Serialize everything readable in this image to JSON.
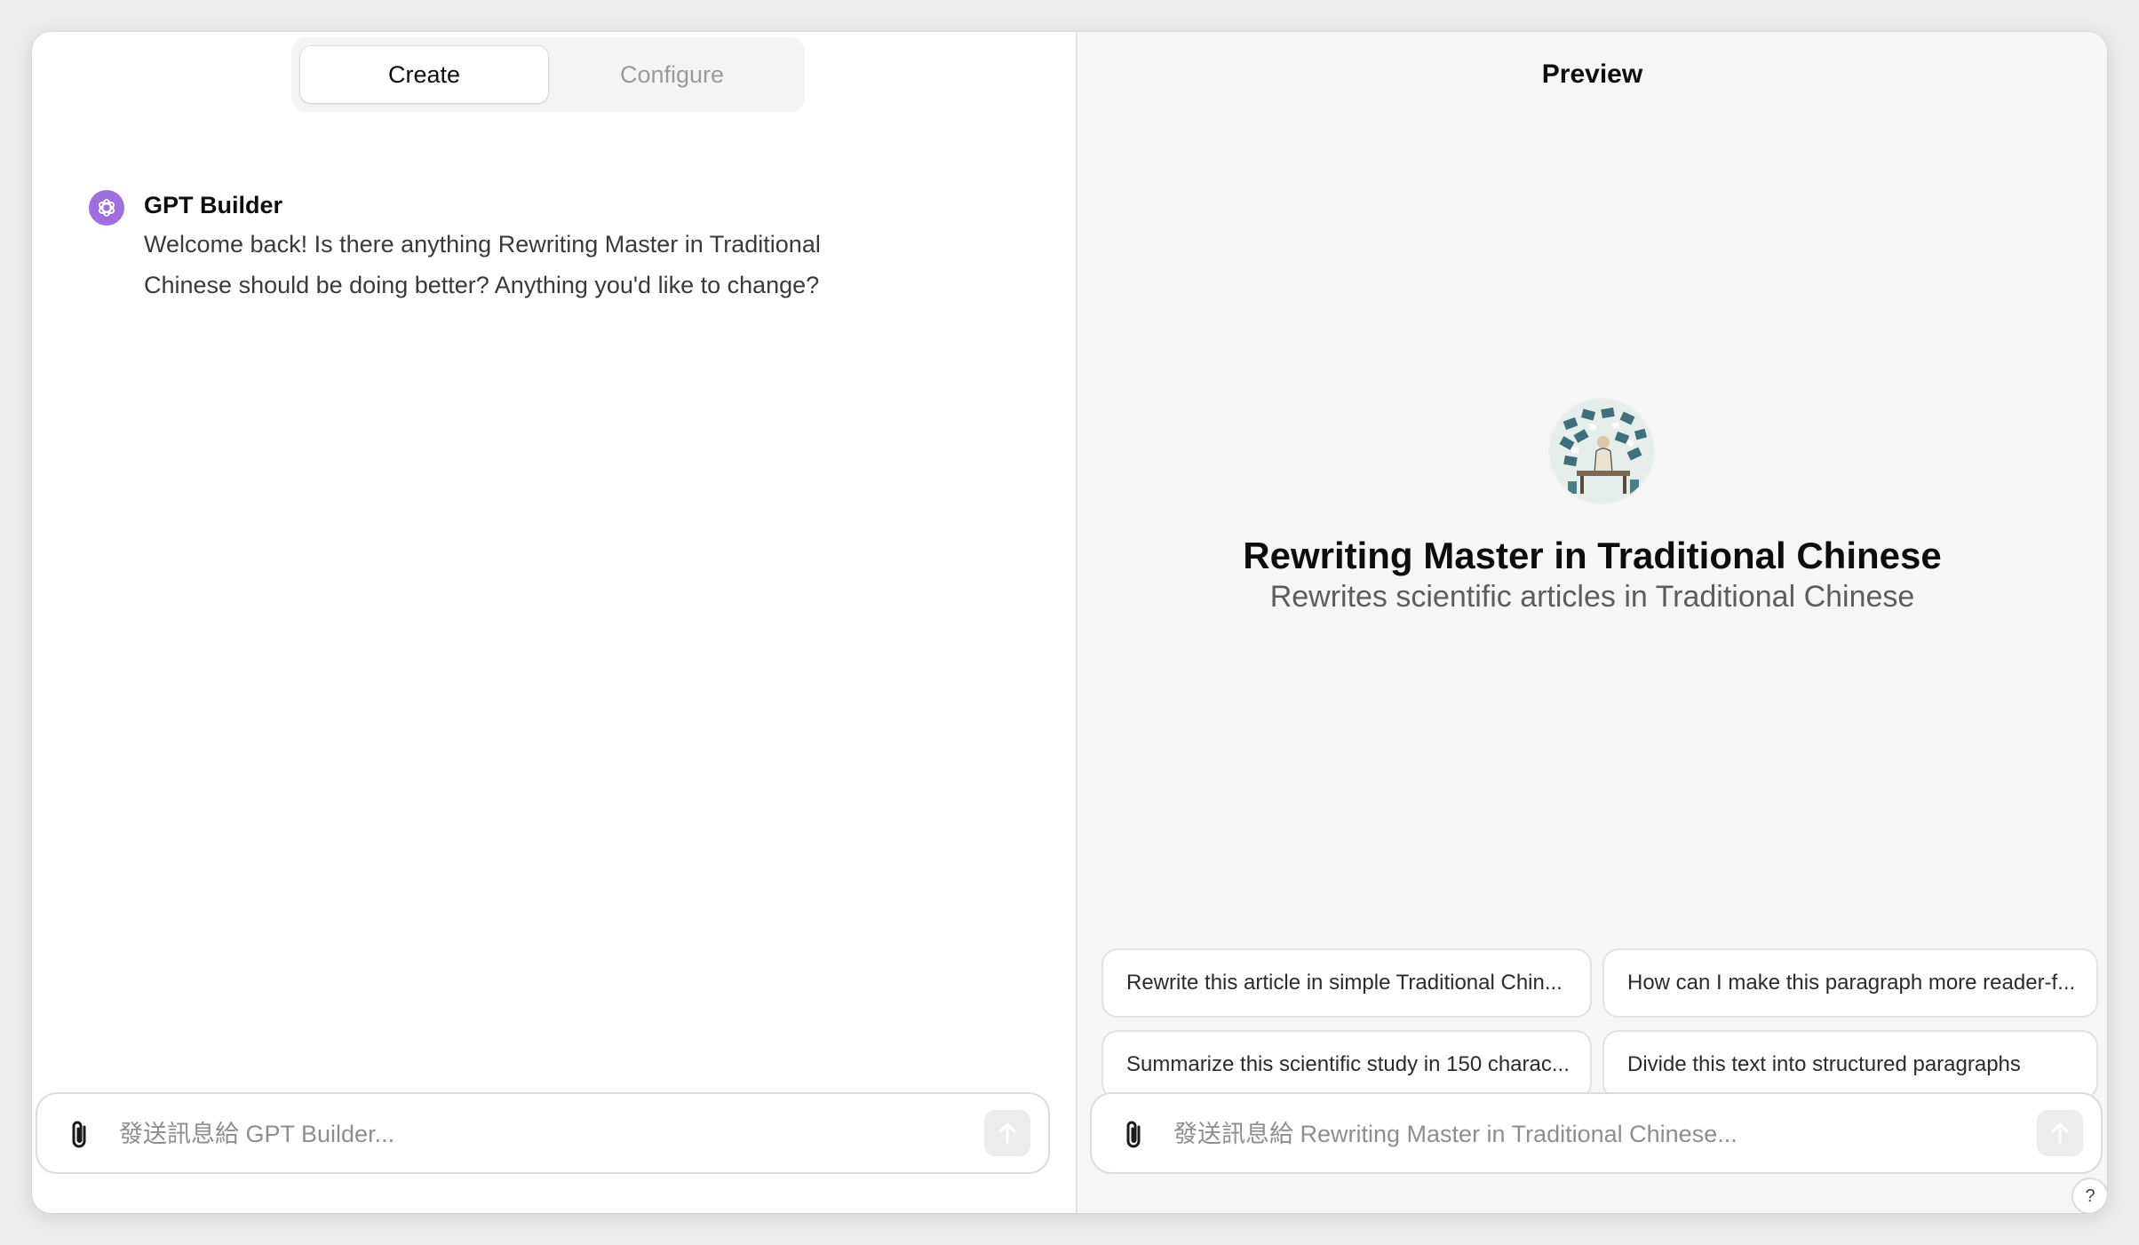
{
  "tabs": [
    {
      "label": "Create",
      "active": true
    },
    {
      "label": "Configure",
      "active": false
    }
  ],
  "builder_message": {
    "author": "GPT Builder",
    "text": "Welcome back! Is there anything Rewriting Master in Traditional Chinese should be doing better? Anything you'd like to change?",
    "avatar_icon": "openai-logo-icon",
    "avatar_color": "#a06de0"
  },
  "left_composer": {
    "placeholder": "發送訊息給 GPT Builder...",
    "attach_icon": "paperclip-icon",
    "send_icon": "arrow-up-icon"
  },
  "preview": {
    "title": "Preview",
    "gpt_name": "Rewriting Master in Traditional Chinese",
    "gpt_description": "Rewrites scientific articles in Traditional Chinese",
    "avatar_icon": "gpt-avatar-illustration",
    "suggestions": [
      "Rewrite this article in simple Traditional Chin...",
      "How can I make this paragraph more reader-f...",
      "Summarize this scientific study in 150 charac...",
      "Divide this text into structured paragraphs"
    ]
  },
  "right_composer": {
    "placeholder": "發送訊息給 Rewriting Master in Traditional Chinese...",
    "attach_icon": "paperclip-icon",
    "send_icon": "arrow-up-icon"
  },
  "help": {
    "label": "?"
  },
  "colors": {
    "accent_purple": "#a06de0",
    "preview_bg": "#f6f6f7",
    "border": "#dcdcdc"
  }
}
